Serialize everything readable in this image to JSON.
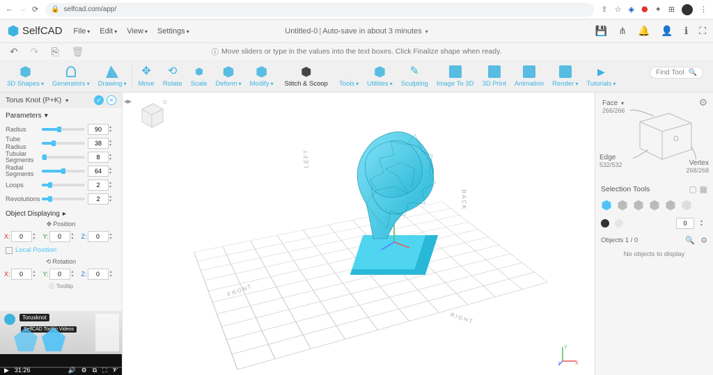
{
  "browser": {
    "url": "selfcad.com/app/"
  },
  "brand": "SelfCAD",
  "menu": {
    "file": "File",
    "edit": "Edit",
    "view": "View",
    "settings": "Settings"
  },
  "title": {
    "doc": "Untitled-0",
    "autosave": "Auto-save in about 3 minutes"
  },
  "hint": "Move sliders or type in the values into the text boxes. Click Finalize shape when ready.",
  "ribbon": {
    "shapes": "3D Shapes",
    "generators": "Generators",
    "drawing": "Drawing",
    "move": "Move",
    "rotate": "Rotate",
    "scale": "Scale",
    "deform": "Deform",
    "modify": "Modify",
    "stitch": "Stitch & Scoop",
    "tools": "Tools",
    "utilities": "Utilities",
    "sculpting": "Sculpting",
    "image3d": "Image To 3D",
    "print": "3D Print",
    "animation": "Animation",
    "render": "Render",
    "tutorials": "Tutorials",
    "find": "Find Tool"
  },
  "panel": {
    "title": "Torus Knot (P+K)",
    "parameters": "Parameters",
    "radius": "Radius",
    "radius_v": "90",
    "tube": "Tube Radius",
    "tube_v": "38",
    "tubseg1": "Tubular",
    "tubseg2": "Segments",
    "tubseg_v": "8",
    "radseg1": "Radial",
    "radseg2": "Segments",
    "radseg_v": "64",
    "loops": "Loops",
    "loops_v": "2",
    "rev": "Revolutions",
    "rev_v": "2",
    "objdisp": "Object Displaying",
    "position": "Position",
    "rotation": "Rotation",
    "local": "Local Position",
    "tooltip": "Tooltip",
    "x": "X:",
    "y": "Y:",
    "z": "Z:",
    "zero": "0"
  },
  "tutorial": {
    "title": "Torusknot",
    "sub": "SelfCAD Tooltip Videos",
    "time": "31:26"
  },
  "vp_labels": {
    "left": "LEFT",
    "right": "RIGHT",
    "front": "FRONT",
    "back": "BACK"
  },
  "right": {
    "face": "Face",
    "face_c": "266/266",
    "edge": "Edge",
    "edge_c": "532/532",
    "vertex": "Vertex",
    "vertex_c": "268/268",
    "seltools": "Selection Tools",
    "zero": "0",
    "objcount": "Objects 1 / 0",
    "noobj": "No objects to display"
  }
}
